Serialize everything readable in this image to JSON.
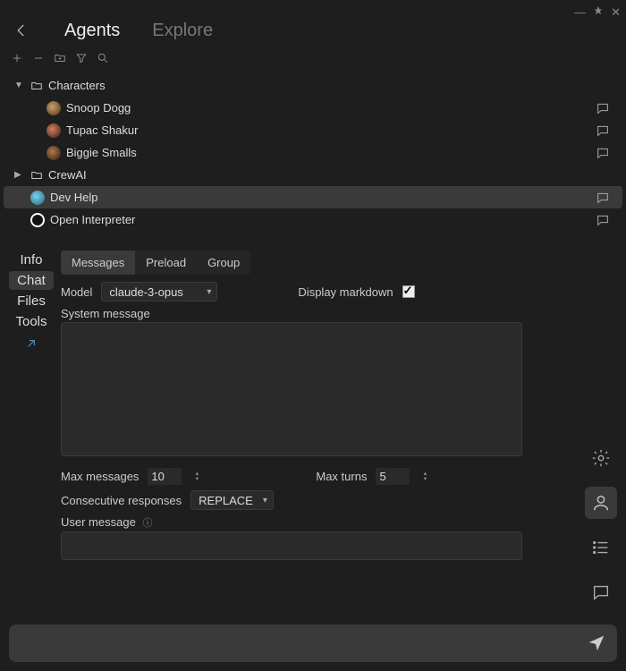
{
  "window": {
    "minimize": "—",
    "pin": "📌",
    "close": "✕"
  },
  "header": {
    "tabs": [
      {
        "label": "Agents",
        "active": true
      },
      {
        "label": "Explore",
        "active": false
      }
    ]
  },
  "tree": {
    "folders": [
      {
        "label": "Characters",
        "expanded": true
      },
      {
        "label": "CrewAI",
        "expanded": false
      }
    ],
    "characters": [
      {
        "label": "Snoop Dogg"
      },
      {
        "label": "Tupac Shakur"
      },
      {
        "label": "Biggie Smalls"
      }
    ],
    "agents": [
      {
        "label": "Dev Help",
        "selected": true
      },
      {
        "label": "Open Interpreter",
        "selected": false
      }
    ]
  },
  "sidetabs": {
    "items": [
      "Info",
      "Chat",
      "Files",
      "Tools"
    ],
    "active": "Chat"
  },
  "inner_tabs": {
    "items": [
      "Messages",
      "Preload",
      "Group"
    ],
    "active": "Messages"
  },
  "chat_settings": {
    "model_label": "Model",
    "model_value": "claude-3-opus",
    "display_markdown_label": "Display markdown",
    "display_markdown_checked": true,
    "system_message_label": "System message",
    "system_message_value": "",
    "max_messages_label": "Max messages",
    "max_messages_value": "10",
    "max_turns_label": "Max turns",
    "max_turns_value": "5",
    "consecutive_label": "Consecutive responses",
    "consecutive_value": "REPLACE",
    "user_message_label": "User message",
    "user_message_value": ""
  },
  "chatbar": {
    "placeholder": ""
  }
}
